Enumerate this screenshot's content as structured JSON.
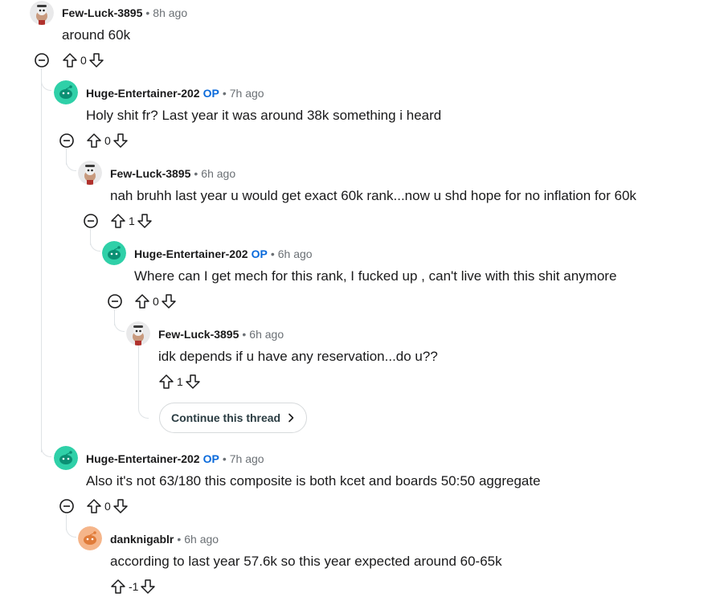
{
  "comments": [
    {
      "user": "Few-Luck-3895",
      "op": "",
      "time": "8h ago",
      "text": "around 60k",
      "votes": "0",
      "avatar": "skull"
    },
    {
      "user": "Huge-Entertainer-202",
      "op": "OP",
      "time": "7h ago",
      "text": "Holy shit fr? Last year it was around 38k something i heard",
      "votes": "0",
      "avatar": "snoo-teal"
    },
    {
      "user": "Few-Luck-3895",
      "op": "",
      "time": "6h ago",
      "text": "nah bruhh last year u would get exact 60k rank...now u shd hope for no inflation for 60k",
      "votes": "1",
      "avatar": "skull"
    },
    {
      "user": "Huge-Entertainer-202",
      "op": "OP",
      "time": "6h ago",
      "text": "Where can I get mech for this rank, I fucked up , can't live with this shit anymore",
      "votes": "0",
      "avatar": "snoo-teal"
    },
    {
      "user": "Few-Luck-3895",
      "op": "",
      "time": "6h ago",
      "text": "idk depends if u have any reservation...do u??",
      "votes": "1",
      "avatar": "skull"
    },
    {
      "user": "Huge-Entertainer-202",
      "op": "OP",
      "time": "7h ago",
      "text": "Also it's not 63/180 this composite is both kcet and boards 50:50 aggregate",
      "votes": "0",
      "avatar": "snoo-teal"
    },
    {
      "user": "danknigablr",
      "op": "",
      "time": "6h ago",
      "text": "according to last year 57.6k so this year expected around 60-65k",
      "votes": "-1",
      "avatar": "snoo-orange"
    }
  ],
  "continue_thread": {
    "label": "Continue this thread"
  },
  "separator": "•",
  "icons": {
    "upvote": "upvote-arrow-icon",
    "downvote": "downvote-arrow-icon",
    "collapse": "collapse-minus-icon",
    "chevron": "chevron-right-icon"
  }
}
